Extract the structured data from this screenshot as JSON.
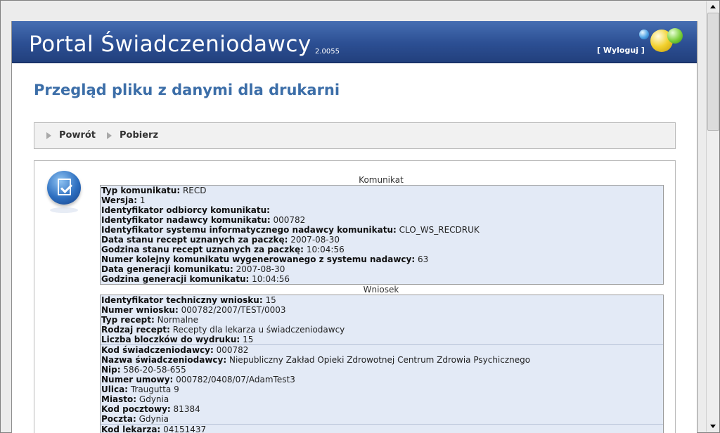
{
  "header": {
    "title": "Portal Świadczeniodawcy",
    "version": "2.0055",
    "logout_label": "[ Wyloguj ]"
  },
  "page_title": "Przegląd pliku z danymi dla drukarni",
  "toolbar": {
    "back_label": "Powrót",
    "download_label": "Pobierz"
  },
  "komunikat": {
    "title": "Komunikat",
    "rows": [
      {
        "label": "Typ komunikatu:",
        "value": "RECD"
      },
      {
        "label": "Wersja:",
        "value": "1"
      },
      {
        "label": "Identyfikator odbiorcy komunikatu:",
        "value": ""
      },
      {
        "label": "Identyfikator nadawcy komunikatu:",
        "value": "000782"
      },
      {
        "label": "Identyfikator systemu informatycznego nadawcy komunikatu:",
        "value": "CLO_WS_RECDRUK"
      },
      {
        "label": "Data stanu recept uznanych za paczkę:",
        "value": "2007-08-30"
      },
      {
        "label": "Godzina stanu recept uznanych za paczkę:",
        "value": "10:04:56"
      },
      {
        "label": "Numer kolejny komunikatu wygenerowanego z systemu nadawcy:",
        "value": "63"
      },
      {
        "label": "Data generacji komunikatu:",
        "value": "2007-08-30"
      },
      {
        "label": "Godzina generacji komunikatu:",
        "value": "10:04:56"
      }
    ]
  },
  "wniosek": {
    "title": "Wniosek",
    "group1": [
      {
        "label": "Identyfikator techniczny wniosku:",
        "value": "15"
      },
      {
        "label": "Numer wniosku:",
        "value": "000782/2007/TEST/0003"
      },
      {
        "label": "Typ recept:",
        "value": "Normalne"
      },
      {
        "label": "Rodzaj recept:",
        "value": "Recepty dla lekarza u świadczeniodawcy"
      },
      {
        "label": "Liczba bloczków do wydruku:",
        "value": "15"
      }
    ],
    "group2": [
      {
        "label": "Kod świadczeniodawcy:",
        "value": "000782"
      },
      {
        "label": "Nazwa świadczeniodawcy:",
        "value": "Niepubliczny Zakład Opieki Zdrowotnej Centrum Zdrowia Psychicznego"
      },
      {
        "label": "Nip:",
        "value": "586-20-58-655"
      },
      {
        "label": "Numer umowy:",
        "value": "000782/0408/07/AdamTest3"
      },
      {
        "label": "Ulica:",
        "value": "Traugutta 9"
      },
      {
        "label": "Miasto:",
        "value": "Gdynia"
      },
      {
        "label": "Kod pocztowy:",
        "value": "81384"
      },
      {
        "label": "Poczta:",
        "value": "Gdynia"
      }
    ],
    "group3": [
      {
        "label": "Kod lekarza:",
        "value": "04151437"
      }
    ]
  },
  "icons": {
    "document": "document-check-icon"
  }
}
